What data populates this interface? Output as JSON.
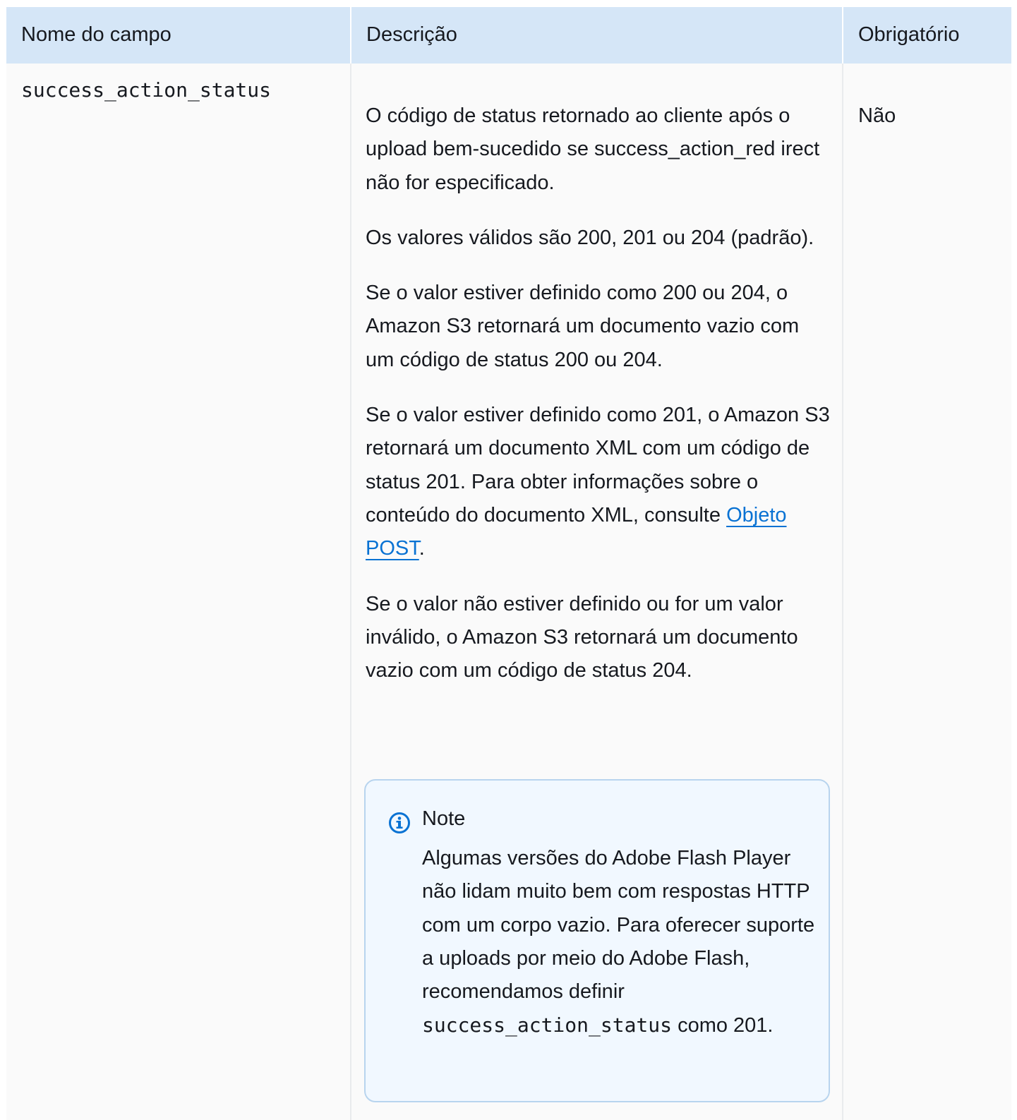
{
  "table": {
    "headers": [
      "Nome do campo",
      "Descrição",
      "Obrigatório"
    ],
    "row": {
      "field": "success_action_status",
      "description": [
        "O código de status retornado ao cliente após o upload bem-sucedido se success_action_red irect não for especificado.",
        "Os valores válidos são 200, 201 ou 204 (padrão).",
        "Se o valor estiver definido como 200 ou 204, o Amazon S3 retornará um documento vazio com um código de status 200 ou 204.",
        "Se o valor não estiver definido ou for um valor inválido, o Amazon S3 retornará um documento vazio com um código de status 204."
      ],
      "xml_paragraph": {
        "text_before": "Se o valor estiver definido como 201, o Amazon S3 retornará um documento XML com um código de status 201. Para obter informações sobre o conteúdo do documento XML, consulte ",
        "link_text": "Objeto POST",
        "text_after": "."
      },
      "required": "Não"
    }
  },
  "note": {
    "icon": "info-icon",
    "title": "Note",
    "body_before": "Algumas versões do Adobe Flash Player não lidam muito bem com respostas HTTP com um corpo vazio. Para oferecer suporte a uploads por meio do Adobe Flash, recomendamos definir ",
    "body_code": "success_action_status",
    "body_after": " como 201."
  },
  "colors": {
    "header_bg": "#d5e6f7",
    "link": "#0972d3",
    "note_border": "#b8d4ee",
    "note_bg": "#f1f8ff",
    "icon": "#0972d3"
  }
}
